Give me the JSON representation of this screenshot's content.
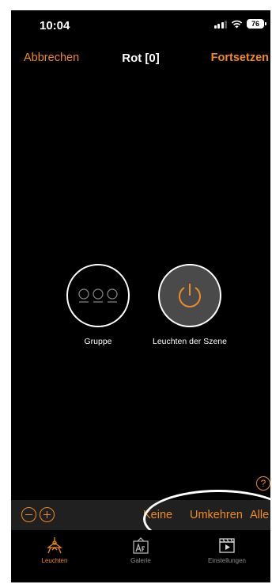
{
  "status": {
    "time": "10:04",
    "battery": "76"
  },
  "nav": {
    "cancel": "Abbrechen",
    "title": "Rot [0]",
    "continue": "Fortsetzen"
  },
  "tiles": {
    "group_label": "Gruppe",
    "scene_label": "Leuchten der Szene"
  },
  "help": {
    "icon": "question-mark",
    "glyph": "?"
  },
  "toolbar": {
    "zoom_out_icon": "minus-circle-icon",
    "zoom_in_icon": "plus-circle-icon",
    "none": "Keine",
    "invert": "Umkehren",
    "all": "Alle"
  },
  "tabs": [
    {
      "label": "Leuchten",
      "icon": "lamp-icon",
      "active": true
    },
    {
      "label": "Galerie",
      "icon": "gallery-icon",
      "active": false
    },
    {
      "label": "Einstellungen",
      "icon": "clapper-icon",
      "active": false
    }
  ],
  "colors": {
    "accent": "#f08a24",
    "background": "#000000",
    "toolbar": "#202020",
    "inactive": "#8e8e8e"
  }
}
